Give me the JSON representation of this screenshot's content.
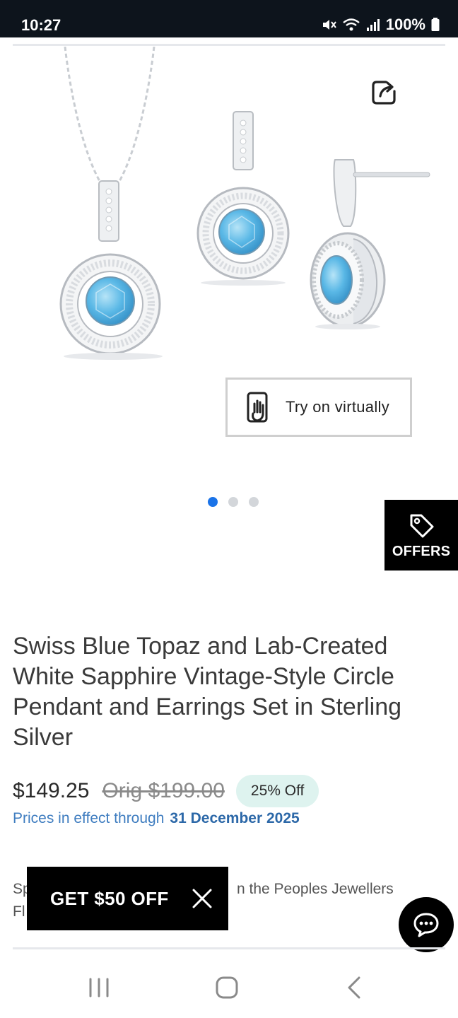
{
  "status_bar": {
    "time": "10:27",
    "battery": "100%",
    "icons": [
      "mute-icon",
      "wifi-icon",
      "signal-icon",
      "battery-icon"
    ]
  },
  "product": {
    "image_alt": "Swiss blue topaz pendant and earrings set",
    "title": "Swiss Blue Topaz and Lab-Created White Sapphire Vintage-Style Circle Pendant and Earrings Set in Sterling Silver",
    "sale_price": "$149.25",
    "orig_price": "Orig $199.00",
    "discount": "25% Off",
    "prices_effect_label": "Prices in effect through",
    "prices_effect_date": "31 December 2025",
    "promo_text_left": "Sp\nFl",
    "promo_text_right": "n the Peoples Jewellers"
  },
  "gallery": {
    "try_on_label": "Try on virtually",
    "slides": 3,
    "active_slide": 1
  },
  "offers": {
    "label": "OFFERS"
  },
  "get_off_banner": {
    "label": "GET $50 OFF"
  },
  "colors": {
    "accent_blue": "#1a73e8",
    "price_link": "#3f7dc0",
    "badge_bg": "#def3ef",
    "topaz": "#5ab8e6"
  },
  "nav": {
    "icons": [
      "recent-apps-icon",
      "home-icon",
      "back-icon"
    ]
  }
}
